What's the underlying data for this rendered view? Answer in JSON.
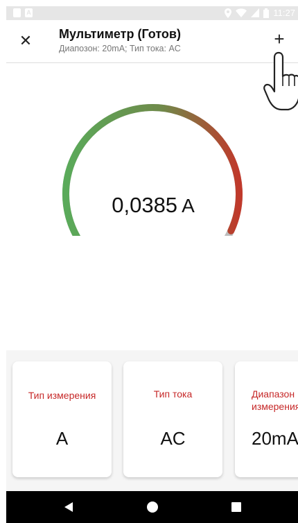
{
  "status_bar": {
    "time": "11:27",
    "left_icons": [
      "sd-card-icon",
      "a-notification-icon"
    ],
    "right_icons": [
      "location-icon",
      "wifi-icon",
      "signal-icon",
      "battery-icon"
    ]
  },
  "app_bar": {
    "title": "Мультиметр (Готов)",
    "subtitle": "Диапозон: 20mA; Тип тока: AC",
    "close_icon": "close-icon",
    "add_icon": "plus-icon"
  },
  "gauge": {
    "value": "0,0385",
    "unit": "A",
    "level": 0.96,
    "colors": {
      "start": "#5aaa5a",
      "mid": "#6f8a4a",
      "end": "#c0392b",
      "track": "#bdbdbd"
    }
  },
  "cards": [
    {
      "label": "Тип измерения",
      "value": "A"
    },
    {
      "label": "Тип тока",
      "value": "AC"
    },
    {
      "label_line1": "Диапазон",
      "label_line2": "измерения",
      "value": "20mA"
    }
  ],
  "nav": {
    "back_icon": "back-triangle-icon",
    "home_icon": "home-circle-icon",
    "recent_icon": "recent-square-icon"
  },
  "colors": {
    "accent_red": "#c62828",
    "card_area_bg": "#f5f5f5"
  }
}
